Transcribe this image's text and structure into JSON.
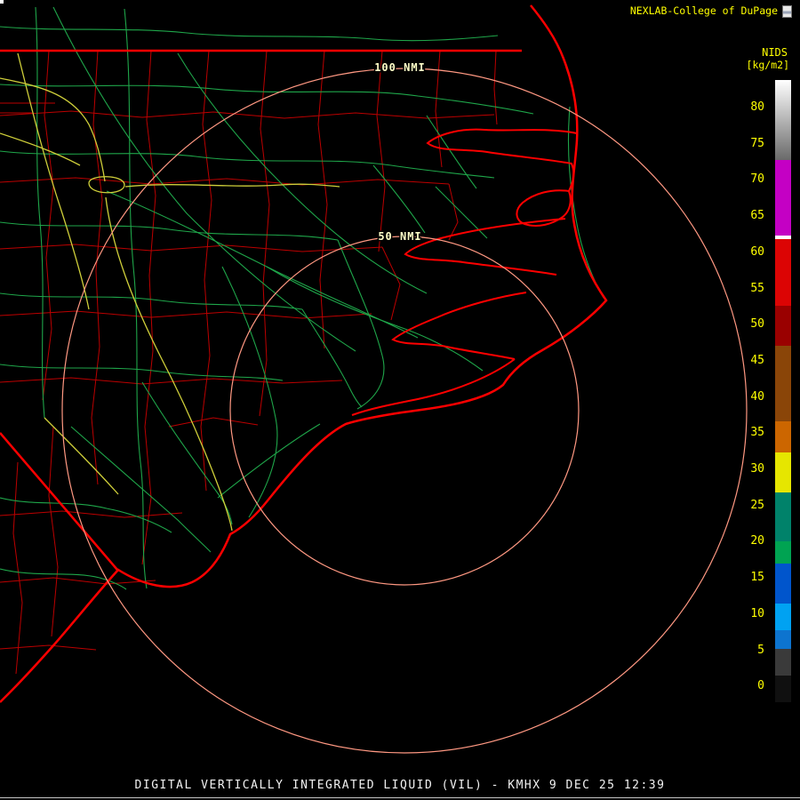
{
  "header": {
    "brand": "NEXLAB-College of DuPage"
  },
  "legend": {
    "title": "NIDS",
    "units": "[kg/m2]",
    "labels": [
      "80",
      "75",
      "70",
      "65",
      "60",
      "55",
      "50",
      "45",
      "40",
      "35",
      "30",
      "25",
      "20",
      "15",
      "10",
      "5",
      "0"
    ],
    "segments": [
      {
        "height": 90,
        "colors": [
          "#ffffff",
          "#6a6a6a"
        ]
      },
      {
        "height": 85,
        "colors": [
          "#c400c4"
        ]
      },
      {
        "height": 4,
        "colors": [
          "#ffffff"
        ]
      },
      {
        "height": 75,
        "colors": [
          "#dc0404"
        ]
      },
      {
        "height": 45,
        "colors": [
          "#9a0000"
        ]
      },
      {
        "height": 85,
        "colors": [
          "#8a4508"
        ]
      },
      {
        "height": 35,
        "colors": [
          "#cc6600"
        ]
      },
      {
        "height": 45,
        "colors": [
          "#e6e600"
        ]
      },
      {
        "height": 55,
        "colors": [
          "#00826a"
        ]
      },
      {
        "height": 25,
        "colors": [
          "#00a352"
        ]
      },
      {
        "height": 45,
        "colors": [
          "#0055cc"
        ]
      },
      {
        "height": 30,
        "colors": [
          "#00a2f2"
        ]
      },
      {
        "height": 21,
        "colors": [
          "#0d74cf"
        ]
      },
      {
        "height": 30,
        "colors": [
          "#3a3a3a"
        ]
      },
      {
        "height": 30,
        "colors": [
          "#101010"
        ]
      }
    ]
  },
  "rings": {
    "outer_label": "100 NMI",
    "inner_label": "50 NMI"
  },
  "footer": {
    "caption": "DIGITAL VERTICALLY INTEGRATED LIQUID (VIL) - KMHX 9 DEC 25 12:39"
  },
  "colors": {
    "background": "#000000",
    "coastline": "#ff0000",
    "county": "#bc0000",
    "road_green": "#1fa64a",
    "road_yellow": "#cfcf3a",
    "ring": "#ff9882",
    "label_yellow": "#ffff00",
    "ring_label": "#ffffc8",
    "footer_text": "#f2f2f2"
  }
}
